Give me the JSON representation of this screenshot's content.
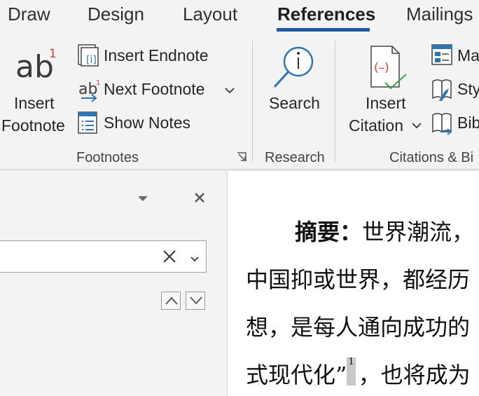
{
  "tabs": [
    {
      "label": "Draw"
    },
    {
      "label": "Design"
    },
    {
      "label": "Layout"
    },
    {
      "label": "References"
    },
    {
      "label": "Mailings"
    }
  ],
  "active_tab": "References",
  "ribbon": {
    "footnotes": {
      "insert_footnote_line1": "Insert",
      "insert_footnote_line2": "Footnote",
      "insert_endnote": "Insert Endnote",
      "next_footnote": "Next Footnote",
      "show_notes": "Show Notes",
      "group_label": "Footnotes"
    },
    "research": {
      "search": "Search",
      "group_label": "Research"
    },
    "citations": {
      "insert_citation_line1": "Insert",
      "insert_citation_line2": "Citation",
      "manage_sources": "Ma",
      "style": "Sty",
      "bibliography": "Bib",
      "group_label": "Citations & Bi"
    }
  },
  "nav_pane": {
    "search_value": ""
  },
  "document": {
    "line1_bold": "摘要：",
    "line1_rest": "世界潮流，",
    "line2": "中国抑或世界，都经历",
    "line3": "想，是每人通向成功的",
    "line4_pre": "式现代化”",
    "line4_fn": "1",
    "line4_post": "，也将成为"
  },
  "colors": {
    "accent": "#1e5aa8",
    "icon_blue": "#2e75b6",
    "footnote_red": "#e03a3a"
  }
}
